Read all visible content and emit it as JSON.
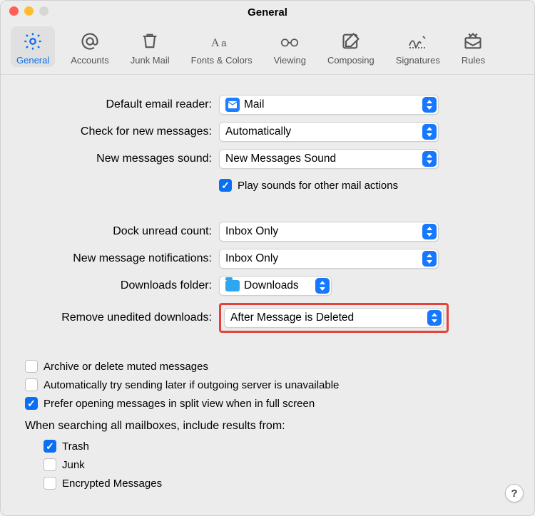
{
  "window": {
    "title": "General"
  },
  "tabs": [
    {
      "label": "General"
    },
    {
      "label": "Accounts"
    },
    {
      "label": "Junk Mail"
    },
    {
      "label": "Fonts & Colors"
    },
    {
      "label": "Viewing"
    },
    {
      "label": "Composing"
    },
    {
      "label": "Signatures"
    },
    {
      "label": "Rules"
    }
  ],
  "labels": {
    "defaultReader": "Default email reader:",
    "checkMessages": "Check for new messages:",
    "newSound": "New messages sound:",
    "playSounds": "Play sounds for other mail actions",
    "dockUnread": "Dock unread count:",
    "newNotifications": "New message notifications:",
    "downloadsFolder": "Downloads folder:",
    "removeDownloads": "Remove unedited downloads:",
    "archiveMuted": "Archive or delete muted messages",
    "retryOutgoing": "Automatically try sending later if outgoing server is unavailable",
    "splitView": "Prefer opening messages in split view when in full screen",
    "searchHeader": "When searching all mailboxes, include results from:",
    "trash": "Trash",
    "junk": "Junk",
    "encrypted": "Encrypted Messages"
  },
  "values": {
    "defaultReader": "Mail",
    "checkMessages": "Automatically",
    "newSound": "New Messages Sound",
    "dockUnread": "Inbox Only",
    "newNotifications": "Inbox Only",
    "downloadsFolder": "Downloads",
    "removeDownloads": "After Message is Deleted"
  },
  "checked": {
    "playSounds": true,
    "archiveMuted": false,
    "retryOutgoing": false,
    "splitView": true,
    "trash": true,
    "junk": false,
    "encrypted": false
  },
  "help": "?"
}
